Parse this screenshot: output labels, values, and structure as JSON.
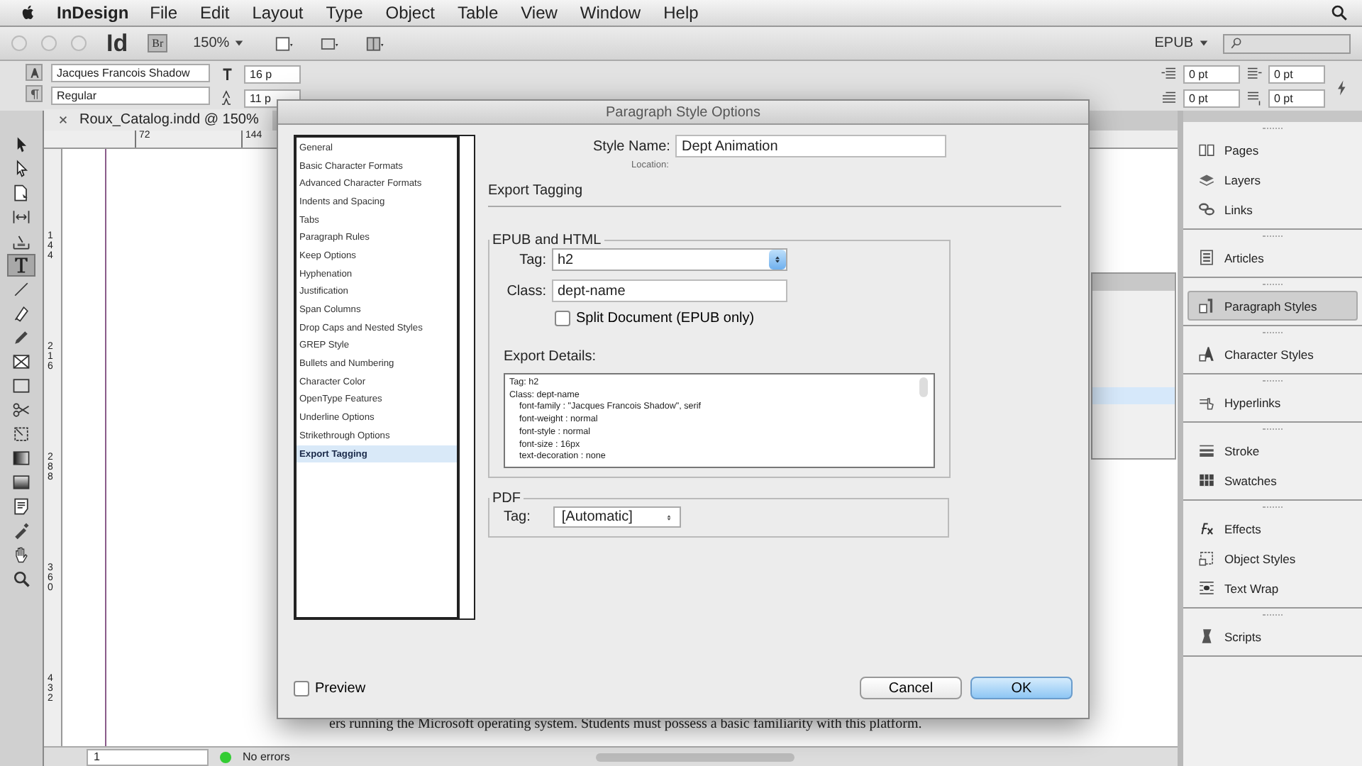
{
  "menu_bar": {
    "app_name": "InDesign",
    "items": [
      "File",
      "Edit",
      "Layout",
      "Type",
      "Object",
      "Table",
      "View",
      "Window",
      "Help"
    ]
  },
  "app_bar": {
    "logo": "Id",
    "bridge": "Br",
    "zoom": "150%",
    "workspace": "EPUB"
  },
  "control_panel": {
    "font_family": "Jacques Francois Shadow",
    "font_style": "Regular",
    "font_size": "16 p",
    "leading": "11 p",
    "spacing": [
      "0 pt",
      "0 pt",
      "0 pt",
      "0 pt"
    ]
  },
  "tools": [
    {
      "kind": "selection",
      "selected": false
    },
    {
      "kind": "direct",
      "selected": false
    },
    {
      "kind": "page",
      "selected": false
    },
    {
      "kind": "gap",
      "selected": false
    },
    {
      "kind": "collector",
      "selected": false
    },
    {
      "kind": "type",
      "selected": true
    },
    {
      "kind": "line",
      "selected": false
    },
    {
      "kind": "pen",
      "selected": false
    },
    {
      "kind": "pencil",
      "selected": false
    },
    {
      "kind": "frame",
      "selected": false
    },
    {
      "kind": "rect",
      "selected": false
    },
    {
      "kind": "scissors",
      "selected": false
    },
    {
      "kind": "transform",
      "selected": false
    },
    {
      "kind": "gradient",
      "selected": false
    },
    {
      "kind": "feather",
      "selected": false
    },
    {
      "kind": "note",
      "selected": false
    },
    {
      "kind": "eyedropper",
      "selected": false
    },
    {
      "kind": "hand",
      "selected": false
    },
    {
      "kind": "zoom",
      "selected": false
    }
  ],
  "document": {
    "tab": "Roux_Catalog.indd @ 150%",
    "ruler_marks": [
      "72",
      "144"
    ],
    "vertical_ruler_marks": [
      "144",
      "216",
      "288",
      "360",
      "432"
    ],
    "body_text": "ers running the Microsoft operating system. Students must possess a basic familiarity with this platform.",
    "page": "1",
    "status": "No errors"
  },
  "dialog": {
    "title": "Paragraph Style Options",
    "categories": [
      {
        "label": "General",
        "selected": false
      },
      {
        "label": "Basic Character Formats",
        "selected": false
      },
      {
        "label": "Advanced Character Formats",
        "selected": false
      },
      {
        "label": "Indents and Spacing",
        "selected": false
      },
      {
        "label": "Tabs",
        "selected": false
      },
      {
        "label": "Paragraph Rules",
        "selected": false
      },
      {
        "label": "Keep Options",
        "selected": false
      },
      {
        "label": "Hyphenation",
        "selected": false
      },
      {
        "label": "Justification",
        "selected": false
      },
      {
        "label": "Span Columns",
        "selected": false
      },
      {
        "label": "Drop Caps and Nested Styles",
        "selected": false
      },
      {
        "label": "GREP Style",
        "selected": false
      },
      {
        "label": "Bullets and Numbering",
        "selected": false
      },
      {
        "label": "Character Color",
        "selected": false
      },
      {
        "label": "OpenType Features",
        "selected": false
      },
      {
        "label": "Underline Options",
        "selected": false
      },
      {
        "label": "Strikethrough Options",
        "selected": false
      },
      {
        "label": "Export Tagging",
        "selected": true
      }
    ],
    "style_name_label": "Style Name:",
    "style_name": "Dept Animation",
    "location_label": "Location:",
    "section": "Export Tagging",
    "epub_group": "EPUB and HTML",
    "tag_label": "Tag:",
    "tag": "h2",
    "class_label": "Class:",
    "class": "dept-name",
    "split_document": {
      "label": "Split Document (EPUB only)",
      "checked": false
    },
    "details_label": "Export Details:",
    "details_header": [
      "Tag: h2",
      "Class: dept-name"
    ],
    "details_properties": [
      "font-family : \"Jacques Francois Shadow\", serif",
      "font-weight : normal",
      "font-style : normal",
      "font-size : 16px",
      "text-decoration : none"
    ],
    "pdf_group": "PDF",
    "pdf_tag_label": "Tag:",
    "pdf_tag": "[Automatic]",
    "preview": {
      "label": "Preview",
      "checked": false
    },
    "buttons": [
      {
        "label": "Cancel",
        "kind": "secondary"
      },
      {
        "label": "OK",
        "kind": "default"
      }
    ]
  },
  "dock": [
    [
      {
        "label": "Pages",
        "kind": "pages",
        "selected": false
      },
      {
        "label": "Layers",
        "kind": "layers",
        "selected": false
      },
      {
        "label": "Links",
        "kind": "links",
        "selected": false
      }
    ],
    [
      {
        "label": "Articles",
        "kind": "articles",
        "selected": false
      }
    ],
    [
      {
        "label": "Paragraph Styles",
        "kind": "para",
        "selected": true
      }
    ],
    [
      {
        "label": "Character Styles",
        "kind": "char",
        "selected": false
      }
    ],
    [
      {
        "label": "Hyperlinks",
        "kind": "hyper",
        "selected": false
      }
    ],
    [
      {
        "label": "Stroke",
        "kind": "stroke",
        "selected": false
      },
      {
        "label": "Swatches",
        "kind": "swatches",
        "selected": false
      }
    ],
    [
      {
        "label": "Effects",
        "kind": "fx",
        "selected": false
      },
      {
        "label": "Object Styles",
        "kind": "objstyle",
        "selected": false
      },
      {
        "label": "Text Wrap",
        "kind": "wrap",
        "selected": false
      }
    ],
    [
      {
        "label": "Scripts",
        "kind": "scripts",
        "selected": false
      }
    ]
  ]
}
